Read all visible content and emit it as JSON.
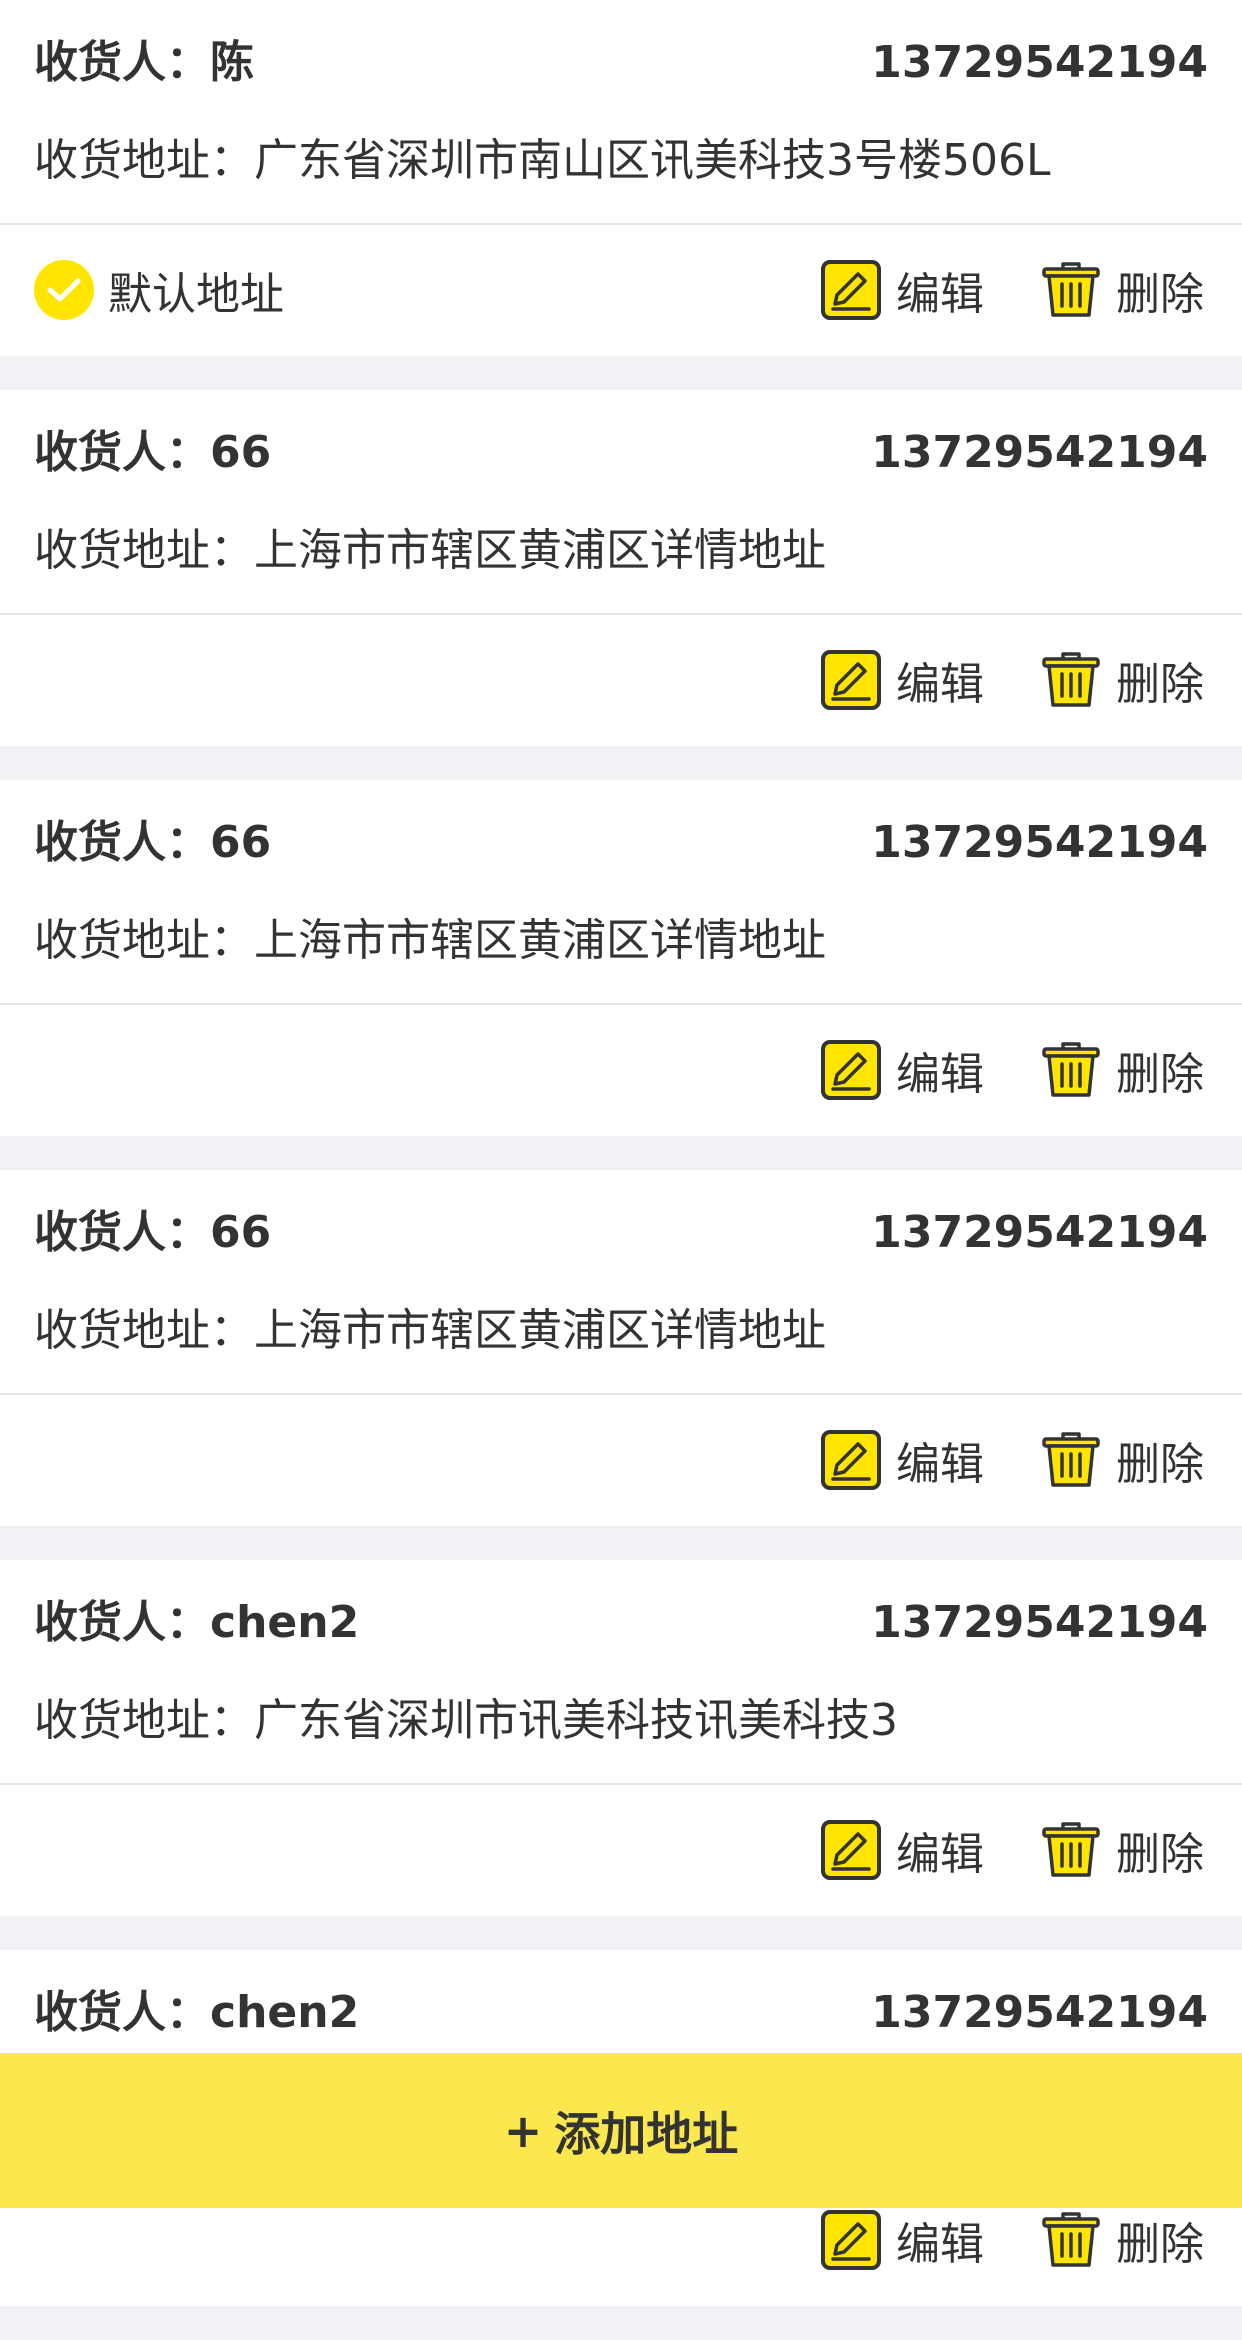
{
  "colors": {
    "accent": "#ffe500",
    "add_bar": "#fbe84e",
    "page_bg": "#f0f2f5",
    "text": "#333333"
  },
  "labels": {
    "receiver_prefix": "收货人：",
    "address_prefix": "收货地址：",
    "default_address": "默认地址",
    "edit": "编辑",
    "delete": "删除"
  },
  "icons": {
    "default": "check-circle-icon",
    "edit": "edit-icon",
    "delete": "trash-icon"
  },
  "addresses": [
    {
      "name": "陈",
      "phone": "13729542194",
      "address": "广东省深圳市南山区讯美科技3号楼506L",
      "is_default": true
    },
    {
      "name": "66",
      "phone": "13729542194",
      "address": "上海市市辖区黄浦区详情地址",
      "is_default": false
    },
    {
      "name": "66",
      "phone": "13729542194",
      "address": "上海市市辖区黄浦区详情地址",
      "is_default": false
    },
    {
      "name": "66",
      "phone": "13729542194",
      "address": "上海市市辖区黄浦区详情地址",
      "is_default": false
    },
    {
      "name": "chen2",
      "phone": "13729542194",
      "address": "广东省深圳市讯美科技讯美科技3",
      "is_default": false
    },
    {
      "name": "chen2",
      "phone": "13729542194",
      "address": "",
      "is_default": false
    }
  ],
  "add_button": {
    "plus": "+",
    "label": "添加地址"
  }
}
